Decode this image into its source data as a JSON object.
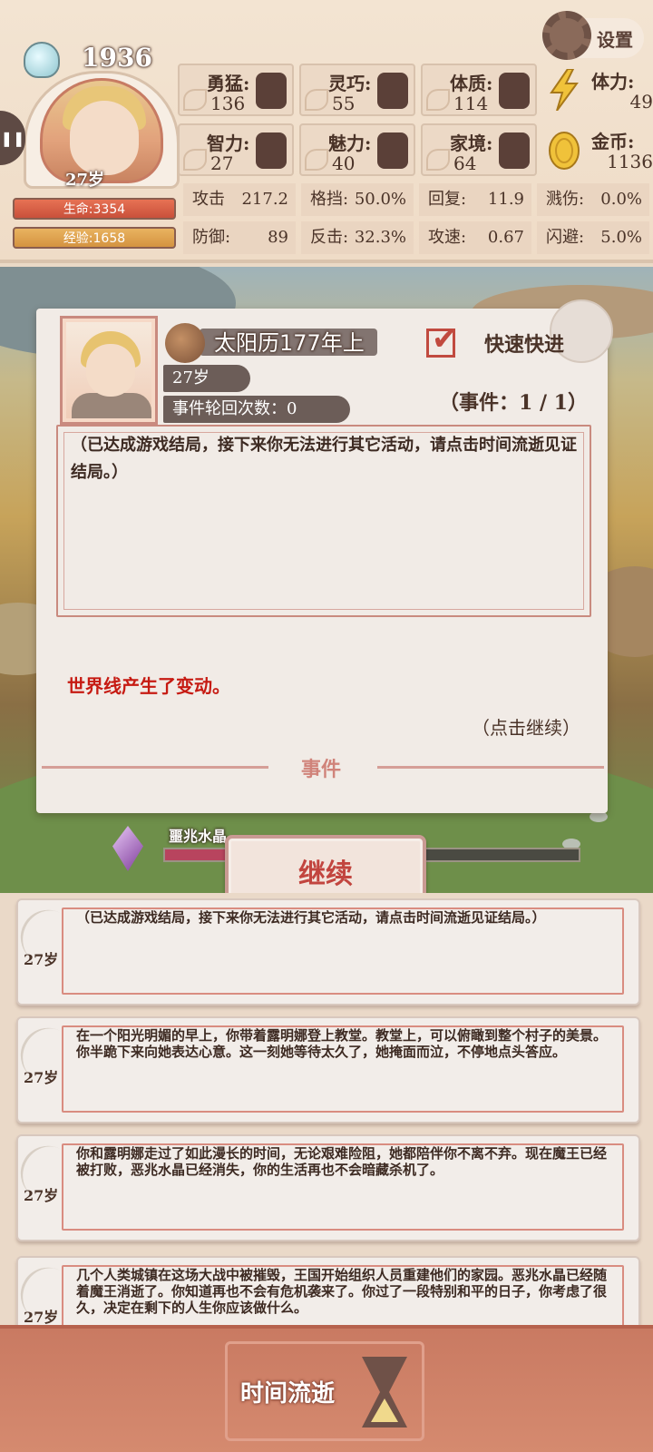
{
  "header": {
    "year": "1936",
    "age": "27岁",
    "settings_label": "设置",
    "hp_label": "生命:3354",
    "hp_fraction": 1.0,
    "exp_label": "经验:1658",
    "exp_fraction": 1.0
  },
  "attributes": [
    {
      "name": "勇猛:",
      "value": "136",
      "icon": "fist-icon"
    },
    {
      "name": "灵巧:",
      "value": "55",
      "icon": "scarf-icon"
    },
    {
      "name": "体质:",
      "value": "114",
      "icon": "muscle-arm-icon"
    },
    {
      "name": "智力:",
      "value": "27",
      "icon": "brain-icon"
    },
    {
      "name": "魅力:",
      "value": "40",
      "icon": "flower-icon"
    },
    {
      "name": "家境:",
      "value": "64",
      "icon": "hand-coin-icon"
    }
  ],
  "resources": {
    "stamina": {
      "name": "体力:",
      "value": "49",
      "icon": "lightning-icon"
    },
    "gold": {
      "name": "金币:",
      "value": "1136",
      "icon": "gold-coin-icon"
    }
  },
  "combat": [
    {
      "label": "攻击",
      "value": "217.2"
    },
    {
      "label": "格挡:",
      "value": "50.0%"
    },
    {
      "label": "回复:",
      "value": "11.9"
    },
    {
      "label": "溅伤:",
      "value": "0.0%"
    },
    {
      "label": "防御:",
      "value": "89"
    },
    {
      "label": "反击:",
      "value": "32.3%"
    },
    {
      "label": "攻速:",
      "value": "0.67"
    },
    {
      "label": "闪避:",
      "value": "5.0%"
    }
  ],
  "dialog": {
    "date": "太阳历177年上",
    "fast_forward_label": "快速快进",
    "fast_forward_checked": true,
    "age_chip": "27岁",
    "cycle_chip": "事件轮回次数：0",
    "event_count": "（事件：1 / 1）",
    "event_text": "（已达成游戏结局，接下来你无法进行其它活动，请点击时间流逝见证结局。）",
    "world_change": "世界线产生了变动。",
    "tap_continue": "（点击继续）",
    "footer_title": "事件"
  },
  "omen": {
    "name": "噩兆水晶",
    "fraction": 0.35
  },
  "continue_label": "继续",
  "log": [
    {
      "age": "27岁",
      "text": "（已达成游戏结局，接下来你无法进行其它活动，请点击时间流逝见证结局。）"
    },
    {
      "age": "27岁",
      "text": "在一个阳光明媚的早上，你带着露明娜登上教堂。教堂上，可以俯瞰到整个村子的美景。你半跪下来向她表达心意。这一刻她等待太久了，她掩面而泣，不停地点头答应。"
    },
    {
      "age": "27岁",
      "text": "你和露明娜走过了如此漫长的时间，无论艰难险阻，她都陪伴你不离不弃。现在魔王已经被打败，恶兆水晶已经消失，你的生活再也不会暗藏杀机了。"
    },
    {
      "age": "27岁",
      "text": "几个人类城镇在这场大战中被摧毁，王国开始组织人员重建他们的家园。恶兆水晶已经随着魔王消逝了。你知道再也不会有危机袭来了。你过了一段特别和平的日子，你考虑了很久，决定在剩下的人生你应该做什么。"
    }
  ],
  "bottom": {
    "time_label": "时间流逝"
  }
}
